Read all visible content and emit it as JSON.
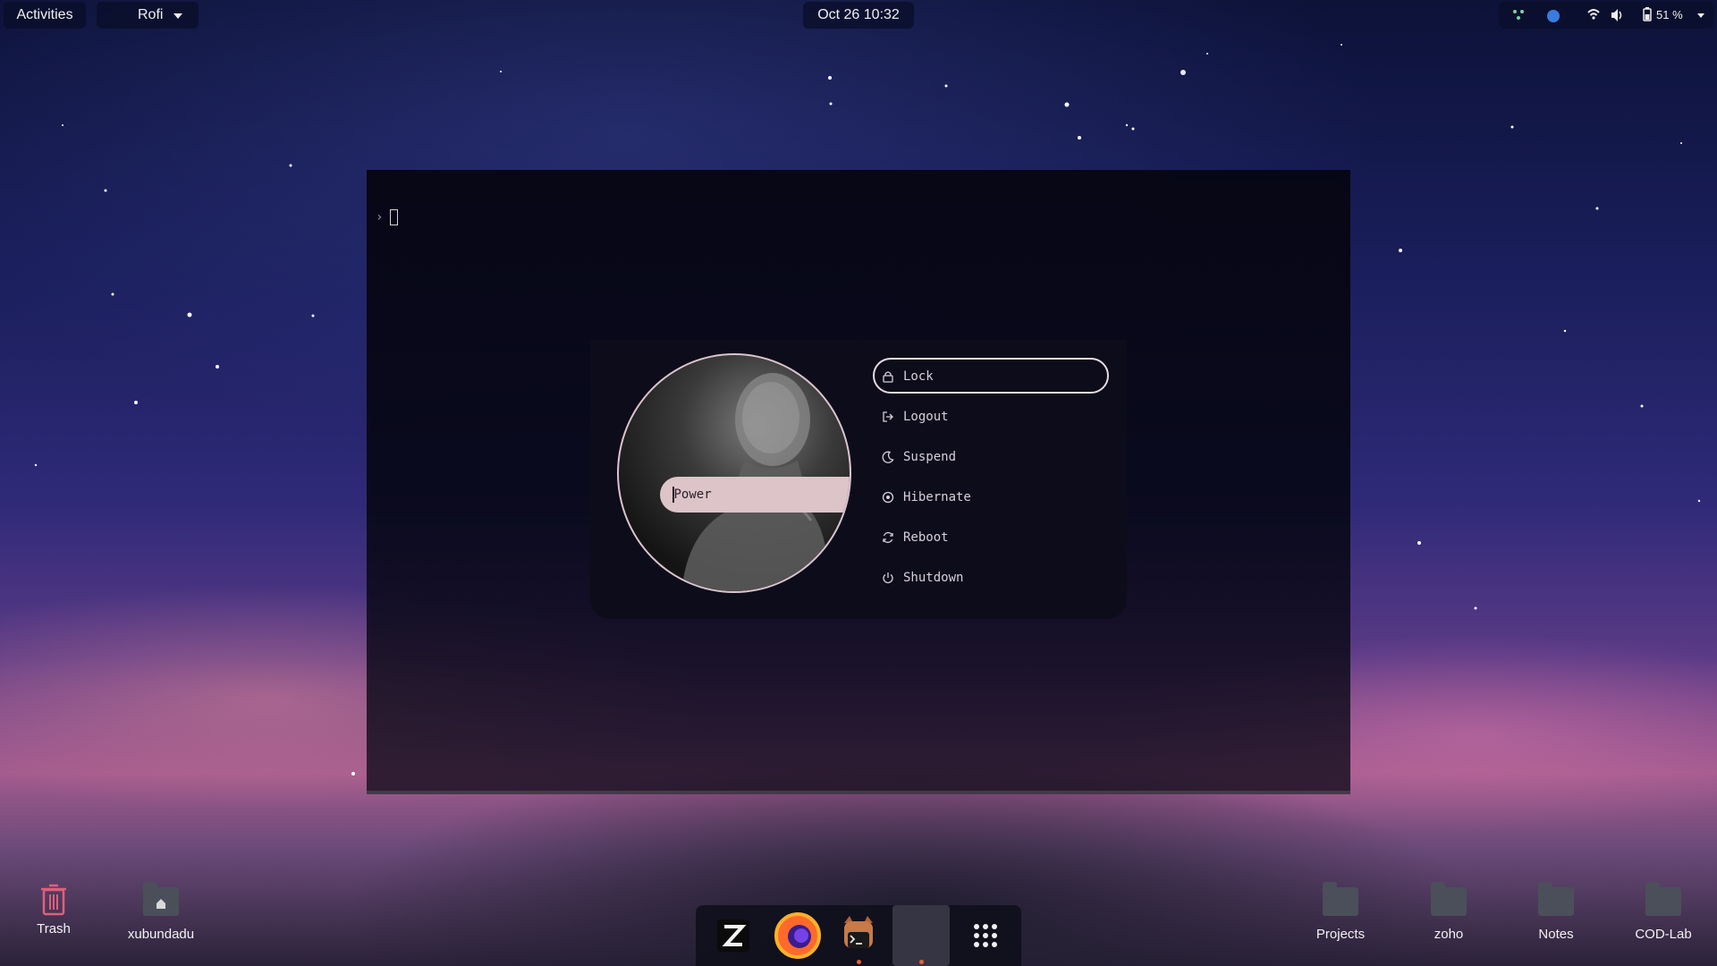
{
  "topbar": {
    "activities": "Activities",
    "app_menu": "Rofi",
    "clock": "Oct 26  10:32",
    "battery": "51 %"
  },
  "rofi": {
    "prompt_symbol": "›",
    "power_input": "Power",
    "options": [
      {
        "label": "Lock",
        "icon": "lock-icon",
        "selected": true
      },
      {
        "label": "Logout",
        "icon": "logout-icon",
        "selected": false
      },
      {
        "label": "Suspend",
        "icon": "moon-icon",
        "selected": false
      },
      {
        "label": "Hibernate",
        "icon": "hibernate-icon",
        "selected": false
      },
      {
        "label": "Reboot",
        "icon": "reboot-icon",
        "selected": false
      },
      {
        "label": "Shutdown",
        "icon": "power-icon",
        "selected": false
      }
    ]
  },
  "desktop": {
    "left_icons": [
      {
        "label": "Trash",
        "icon": "trash-icon"
      },
      {
        "label": "xubundadu",
        "icon": "home-folder-icon"
      }
    ],
    "right_icons": [
      {
        "label": "Projects",
        "icon": "folder-icon"
      },
      {
        "label": "zoho",
        "icon": "folder-icon"
      },
      {
        "label": "Notes",
        "icon": "folder-icon"
      },
      {
        "label": "COD-Lab",
        "icon": "folder-icon"
      }
    ]
  },
  "dock": {
    "items": [
      {
        "name": "zed-editor-icon"
      },
      {
        "name": "firefox-icon"
      },
      {
        "name": "terminal-icon"
      },
      {
        "name": "active-window-icon"
      },
      {
        "name": "show-apps-icon"
      }
    ]
  },
  "colors": {
    "accent": "#dcc4c9",
    "running_dot": "#e8602c",
    "trash": "#e0607a"
  }
}
